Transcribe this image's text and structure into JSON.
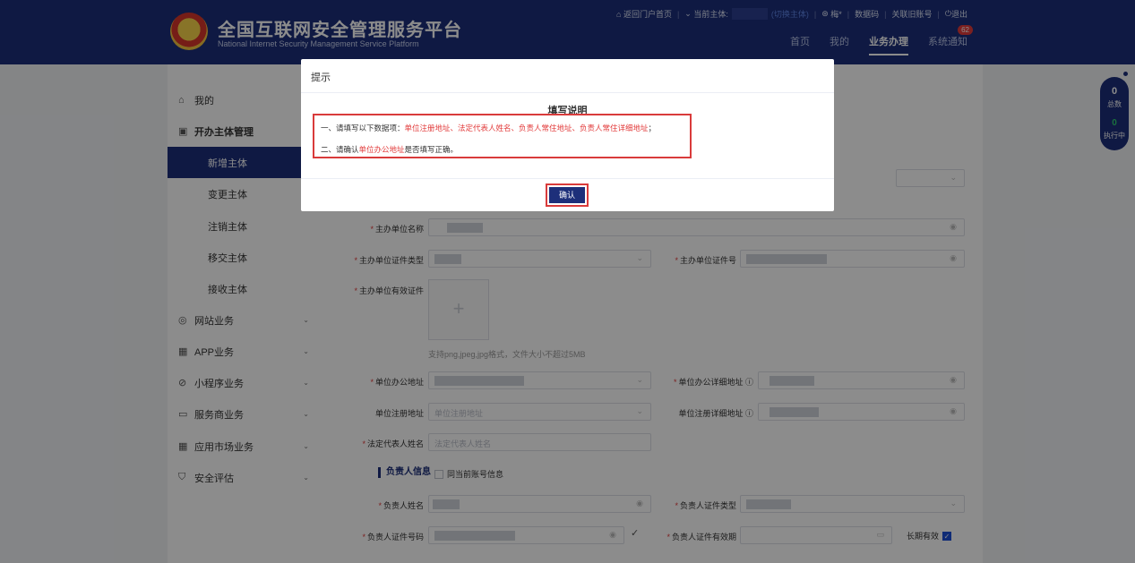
{
  "header": {
    "title": "全国互联网安全管理服务平台",
    "subtitle": "National Internet Security Management Service Platform",
    "links": {
      "portal": "返回门户首页",
      "current_entity_label": "当前主体:",
      "switch_entity": "(切换主体)",
      "user": "梅*",
      "data_code": "数据码",
      "link_account": "关联旧账号",
      "logout": "退出"
    },
    "nav": [
      "首页",
      "我的",
      "业务办理",
      "系统通知"
    ],
    "notice_badge": "62"
  },
  "sidebar": {
    "my": "我的",
    "entity_mgmt": "开办主体管理",
    "sub_items": [
      "新增主体",
      "变更主体",
      "注销主体",
      "移交主体",
      "接收主体"
    ],
    "groups": [
      "网站业务",
      "APP业务",
      "小程序业务",
      "服务商业务",
      "应用市场业务",
      "安全评估"
    ]
  },
  "form": {
    "org_name": "主办单位名称",
    "org_cert_type": "主办单位证件类型",
    "org_cert_no": "主办单位证件号",
    "org_valid_cert": "主办单位有效证件",
    "upload_hint": "支持png,jpeg,jpg格式，文件大小不超过5MB",
    "office_addr": "单位办公地址",
    "office_addr_detail": "单位办公详细地址",
    "reg_addr": "单位注册地址",
    "reg_addr_placeholder": "单位注册地址",
    "reg_addr_detail": "单位注册详细地址",
    "legal_rep": "法定代表人姓名",
    "legal_rep_placeholder": "法定代表人姓名",
    "section_person": "负责人信息",
    "same_as_account": "同当前账号信息",
    "person_name": "负责人姓名",
    "person_cert_type": "负责人证件类型",
    "person_cert_no": "负责人证件号码",
    "person_cert_valid": "负责人证件有效期",
    "long_term": "长期有效"
  },
  "float": {
    "total_count": "0",
    "total_label": "总数",
    "running_count": "0",
    "running_label": "执行中"
  },
  "modal": {
    "title": "提示",
    "heading": "填写说明",
    "line1_prefix": "一、请填写以下数据项：",
    "line1_red": "单位注册地址、法定代表人姓名、负责人常住地址、负责人常住详细地址",
    "line1_suffix": "；",
    "line2_prefix": "二、请确认",
    "line2_red": "单位办公地址",
    "line2_suffix": "是否填写正确。",
    "confirm": "确认"
  },
  "colors": {
    "primary": "#1d2f7a",
    "alert_red": "#e23b3b"
  }
}
